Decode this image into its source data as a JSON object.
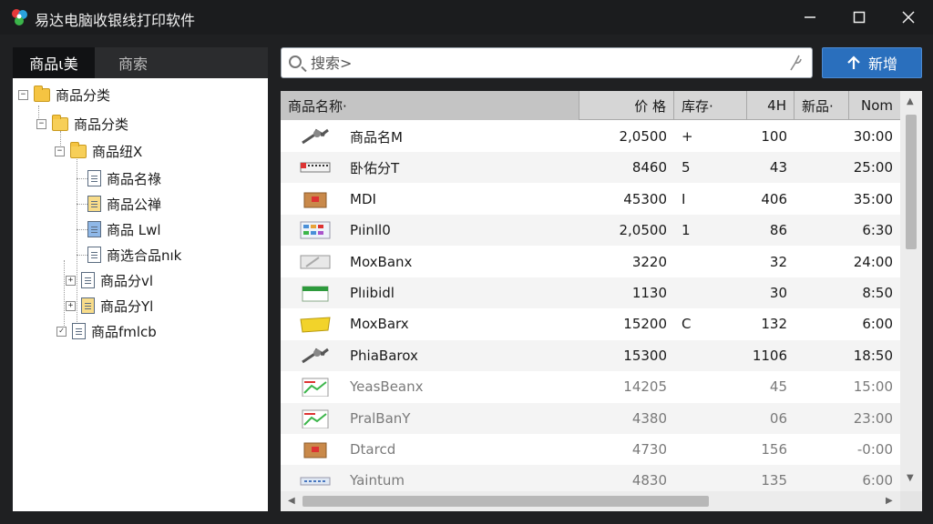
{
  "window": {
    "title": "易达电脑收银线打印软件"
  },
  "left_tabs": [
    {
      "label": "商品ι美"
    },
    {
      "label": "商索"
    }
  ],
  "tree": [
    {
      "label": "商品分类",
      "icon": "folder-icon",
      "expander": "−"
    },
    {
      "label": "商品分类",
      "icon": "folder-open-icon",
      "expander": "−"
    },
    {
      "label": "商品纽X",
      "icon": "folder-open-icon",
      "expander": "−"
    },
    {
      "label": "商品名祿",
      "icon": "document-icon"
    },
    {
      "label": "商品公禅",
      "icon": "document-icon"
    },
    {
      "label": "商品 Lwl",
      "icon": "document-icon"
    },
    {
      "label": "商选合品nık",
      "icon": "document-icon"
    },
    {
      "label": "商品分vl",
      "icon": "document-icon",
      "expander": "+"
    },
    {
      "label": "商品分Yl",
      "icon": "document-icon",
      "expander": "+"
    },
    {
      "label": "商品fmlcb",
      "icon": "document-icon",
      "expander": "✓"
    }
  ],
  "search": {
    "placeholder": "搜索>"
  },
  "new_button": {
    "label": "新增"
  },
  "table": {
    "columns": [
      "商品名称·",
      "价 格",
      "库存·",
      "4H",
      "新品·",
      "Nom"
    ],
    "rows": [
      {
        "name": "商品名M",
        "price": "2,0500",
        "stock": "+",
        "h4": "100",
        "time": "30:00",
        "thumb": "cable"
      },
      {
        "name": "卧佑分T",
        "price": "8460",
        "stock": "5",
        "h4": "43",
        "time": "25:00",
        "thumb": "printer"
      },
      {
        "name": "MDI",
        "price": "45300",
        "stock": "I",
        "h4": "406",
        "time": "35:00",
        "thumb": "box"
      },
      {
        "name": "Pıinll0",
        "price": "2,0500",
        "stock": "1",
        "h4": "86",
        "time": "6:30",
        "thumb": "palette"
      },
      {
        "name": "MoxBanx",
        "price": "3220",
        "stock": "",
        "h4": "32",
        "time": "24:00",
        "thumb": "paper"
      },
      {
        "name": "Plıibidl",
        "price": "1130",
        "stock": "",
        "h4": "30",
        "time": "8:50",
        "thumb": "green-box"
      },
      {
        "name": "MoxBarx",
        "price": "15200",
        "stock": "C",
        "h4": "132",
        "time": "6:00",
        "thumb": "yellow-pack"
      },
      {
        "name": "PhiaBarox",
        "price": "15300",
        "stock": "",
        "h4": "1106",
        "time": "18:50",
        "thumb": "cable"
      },
      {
        "name": "YeasBeanx",
        "price": "14205",
        "stock": "",
        "h4": "45",
        "time": "15:00",
        "thumb": "chart-card"
      },
      {
        "name": "PralBanY",
        "price": "4380",
        "stock": "",
        "h4": "06",
        "time": "23:00",
        "thumb": "chart-card"
      },
      {
        "name": "Dtarcd",
        "price": "4730",
        "stock": "",
        "h4": "156",
        "time": "-0:00",
        "thumb": "box"
      },
      {
        "name": "Yaintum",
        "price": "4830",
        "stock": "",
        "h4": "135",
        "time": "6:00",
        "thumb": "blue-strip"
      }
    ]
  },
  "colors": {
    "accent": "#2a6fbd",
    "titlebar": "#1b1c1e",
    "header": "#d6d6d6"
  }
}
